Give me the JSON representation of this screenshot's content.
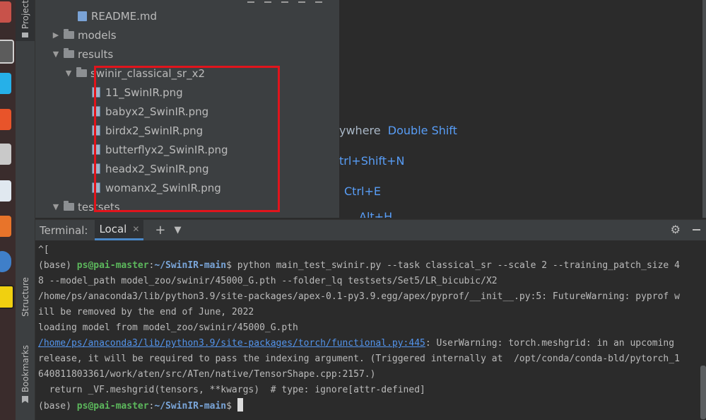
{
  "sidebar": {
    "project_tab": "Project",
    "structure_tab": "Structure",
    "bookmarks_tab": "Bookmarks"
  },
  "project_tree": {
    "items": [
      {
        "label": "README.md",
        "type": "markdown"
      },
      {
        "label": "models",
        "type": "folder",
        "expanded": false
      },
      {
        "label": "results",
        "type": "folder",
        "expanded": true
      },
      {
        "label": "swinir_classical_sr_x2",
        "type": "folder",
        "expanded": true
      },
      {
        "label": "11_SwinIR.png",
        "type": "png"
      },
      {
        "label": "babyx2_SwinIR.png",
        "type": "png"
      },
      {
        "label": "birdx2_SwinIR.png",
        "type": "png"
      },
      {
        "label": "butterflyx2_SwinIR.png",
        "type": "png"
      },
      {
        "label": "headx2_SwinIR.png",
        "type": "png"
      },
      {
        "label": "womanx2_SwinIR.png",
        "type": "png"
      },
      {
        "label": "testsets",
        "type": "folder",
        "expanded": true
      }
    ],
    "highlight_color": "#e1141c"
  },
  "editor_hints": [
    {
      "text": "ywhere",
      "key": "Double Shift"
    },
    {
      "text": "trl+Shift+N",
      "key": ""
    },
    {
      "text": "",
      "key": "Ctrl+E"
    },
    {
      "text": "",
      "key": "Alt+H"
    }
  ],
  "terminal": {
    "title": "Terminal:",
    "tab_label": "Local",
    "prompt_user": "ps@pai-master",
    "prompt_path": "~/SwinIR-main",
    "lines": {
      "l0": "^[",
      "l1_pre": "(base) ",
      "l1_sep": ":",
      "l1_cmd": "$ python main_test_swinir.py --task classical_sr --scale 2 --training_patch_size 4",
      "l2": "8 --model_path model_zoo/swinir/45000_G.pth --folder_lq testsets/Set5/LR_bicubic/X2",
      "l3": "/home/ps/anaconda3/lib/python3.9/site-packages/apex-0.1-py3.9.egg/apex/pyprof/__init__.py:5: FutureWarning: pyprof w",
      "l4": "ill be removed by the end of June, 2022",
      "l5": "loading model from model_zoo/swinir/45000_G.pth",
      "l6_link": "/home/ps/anaconda3/lib/python3.9/site-packages/torch/functional.py:445",
      "l6_rest": ": UserWarning: torch.meshgrid: in an upcoming",
      "l7": "release, it will be required to pass the indexing argument. (Triggered internally at  /opt/conda/conda-bld/pytorch_1",
      "l8": "640811803361/work/aten/src/ATen/native/TensorShape.cpp:2157.)",
      "l9": "  return _VF.meshgrid(tensors, **kwargs)  # type: ignore[attr-defined]",
      "l10_pre": "(base) ",
      "l10_end": "$ "
    }
  }
}
